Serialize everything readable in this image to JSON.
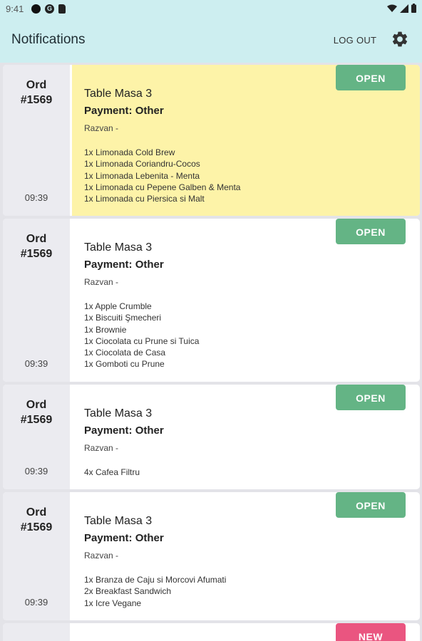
{
  "status_bar": {
    "time": "9:41"
  },
  "app_bar": {
    "title": "Notifications",
    "logout_label": "LOG OUT"
  },
  "colors": {
    "header_bg": "#cdeef0",
    "highlight_bg": "#fdf3a8",
    "open_button": "#64b485",
    "new_button": "#ea5580"
  },
  "notifications": [
    {
      "order_label": "Ord",
      "order_number": "#1569",
      "time": "09:39",
      "title": "Table Masa 3",
      "payment": "Payment: Other",
      "customer": "Razvan -",
      "status": "OPEN",
      "highlighted": true,
      "items": [
        "1x Limonada Cold Brew",
        "1x Limonada Coriandru-Cocos",
        "1x Limonada Lebenita - Menta",
        "1x Limonada cu Pepene Galben & Menta",
        "1x Limonada cu Piersica si Malt"
      ]
    },
    {
      "order_label": "Ord",
      "order_number": "#1569",
      "time": "09:39",
      "title": "Table Masa 3",
      "payment": "Payment: Other",
      "customer": "Razvan -",
      "status": "OPEN",
      "highlighted": false,
      "items": [
        "1x Apple Crumble",
        "1x Biscuiti Şmecheri",
        "1x Brownie",
        "1x Ciocolata cu Prune si Tuica",
        "1x Ciocolata de Casa",
        "1x Gomboti cu Prune"
      ]
    },
    {
      "order_label": "Ord",
      "order_number": "#1569",
      "time": "09:39",
      "title": "Table Masa 3",
      "payment": "Payment: Other",
      "customer": "Razvan -",
      "status": "OPEN",
      "highlighted": false,
      "items": [
        "4x Cafea Filtru"
      ]
    },
    {
      "order_label": "Ord",
      "order_number": "#1569",
      "time": "09:39",
      "title": "Table Masa 3",
      "payment": "Payment: Other",
      "customer": "Razvan -",
      "status": "OPEN",
      "highlighted": false,
      "items": [
        "1x Branza de Caju si Morcovi Afumati",
        "2x Breakfast Sandwich",
        "1x Icre Vegane"
      ]
    },
    {
      "status": "NEW",
      "highlighted": false
    }
  ]
}
